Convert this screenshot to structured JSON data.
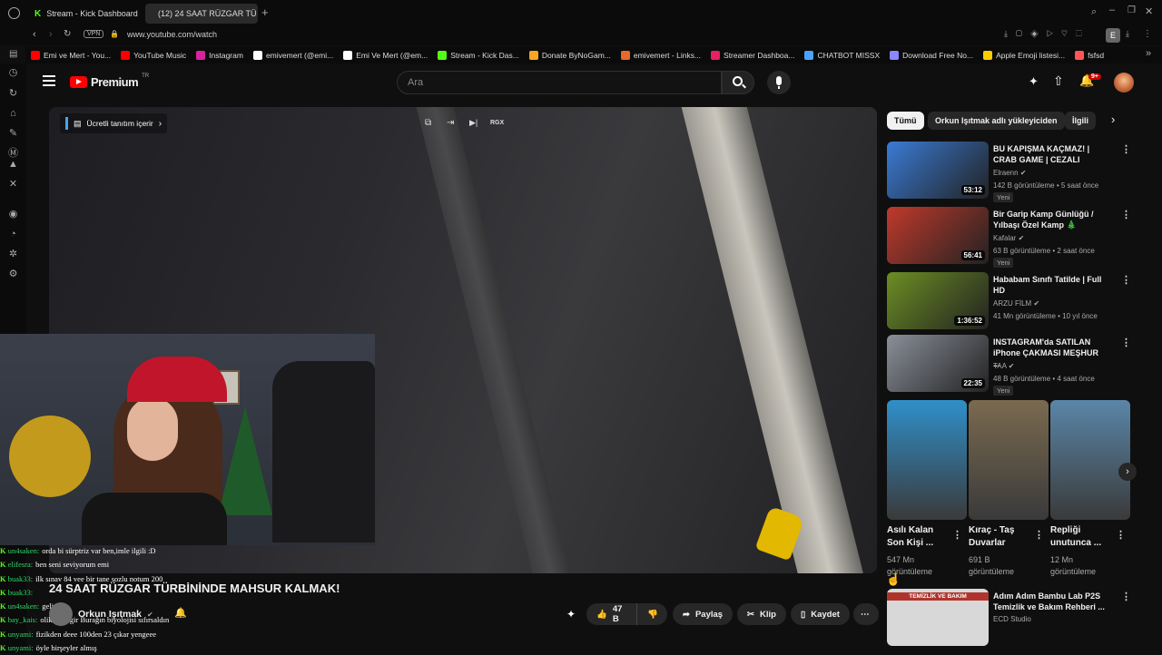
{
  "browser": {
    "tabs": [
      {
        "label": "Stream - Kick Dashboard",
        "active": false
      },
      {
        "label": "(12) 24 SAAT RÜZGAR TÜ",
        "active": true
      }
    ],
    "address": "www.youtube.com/watch",
    "vpn_label": "VPN",
    "profile_letter": "E",
    "bookmarks": [
      {
        "label": "Emi ve Mert - You...",
        "color": "#ff0000"
      },
      {
        "label": "YouTube Music",
        "color": "#ff0000"
      },
      {
        "label": "Instagram",
        "color": "#d6249f"
      },
      {
        "label": "emivemert (@emi...",
        "color": "#ffffff"
      },
      {
        "label": "Emi Ve Mert (@em...",
        "color": "#ffffff"
      },
      {
        "label": "Stream - Kick Das...",
        "color": "#53fc18"
      },
      {
        "label": "Donate ByNoGam...",
        "color": "#f5a623"
      },
      {
        "label": "emivemert - Links...",
        "color": "#e66a2c"
      },
      {
        "label": "Streamer Dashboa...",
        "color": "#e91e63"
      },
      {
        "label": "CHATBOT MISSX",
        "color": "#4aa3ff"
      },
      {
        "label": "Download Free No...",
        "color": "#8888ff"
      },
      {
        "label": "Apple Emoji listesi...",
        "color": "#ffcc00"
      },
      {
        "label": "fsfsd",
        "color": "#ff5555"
      }
    ]
  },
  "youtube": {
    "logo_text": "Premium",
    "logo_sup": "TR",
    "search_placeholder": "Ara",
    "notif_badge": "9+"
  },
  "player": {
    "promo_label": "Ücretli tanıtım içerir",
    "control_label": "RGX"
  },
  "video": {
    "title": "24 SAAT RÜZGAR TÜRBİNİNDE MAHSUR KALMAK!",
    "channel": "Orkun Işıtmak",
    "likes": "47 B",
    "share": "Paylaş",
    "clip": "Klip",
    "save": "Kaydet"
  },
  "chat": [
    {
      "user": "un4saken:",
      "msg": "orda bi sürptriz var ben,imle ilgili :D"
    },
    {
      "user": "elifesra:",
      "msg": "ben seni seviyorum emi"
    },
    {
      "user": "buak33:",
      "msg": "ilk sınav 84 vee bir tane sozlu notum 200"
    },
    {
      "user": "buak33:",
      "msg": ""
    },
    {
      "user": "un4saken:",
      "msg": "gelir mi"
    },
    {
      "user": "bay_kais:",
      "msg": "olik kasa gir Burağın biyolojisi sıfırsaldın"
    },
    {
      "user": "unyami:",
      "msg": "fizikden deee 100den 23 çıkar yengeee"
    },
    {
      "user": "unyami:",
      "msg": "öyle birşeyler almış"
    }
  ],
  "chips": [
    "Tümü",
    "Orkun Işıtmak adlı yükleyiciden",
    "İlgili"
  ],
  "recommendations": [
    {
      "title": "BU KAPIŞMA KAÇMAZ! | CRAB GAME | CEZALI",
      "channel": "Elraenn",
      "meta": "142 B görüntüleme • 5 saat önce",
      "badge": "Yeni",
      "duration": "53:12",
      "thumb": "#3a7bd5"
    },
    {
      "title": "Bir Garip Kamp Günlüğü / Yılbaşı Özel Kamp 🎄",
      "channel": "Kafalar",
      "meta": "63 B görüntüleme • 2 saat önce",
      "badge": "Yeni",
      "duration": "56:41",
      "thumb": "#c0392b"
    },
    {
      "title": "Hababam Sınıfı Tatilde | Full HD",
      "channel": "ARZU FİLM",
      "meta": "41 Mn görüntüleme • 10 yıl önce",
      "badge": "",
      "duration": "1:36:52",
      "thumb": "#6b8e23"
    },
    {
      "title": "INSTAGRAM'da SATILAN iPhone ÇAKMASI MEŞHUR ...",
      "channel": "TAA",
      "meta": "48 B görüntüleme • 4 saat önce",
      "badge": "Yeni",
      "duration": "22:35",
      "thumb": "#8a8f99"
    }
  ],
  "shorts": [
    {
      "title": "Asılı Kalan Son Kişi ...",
      "views": "547 Mn görüntüleme",
      "thumb": "#2f8fc9"
    },
    {
      "title": "Kıraç - Taş Duvarlar",
      "views": "691 B görüntüleme",
      "thumb": "#7a6a4f"
    },
    {
      "title": "Repliği unutunca ...",
      "views": "12 Mn görüntüleme",
      "thumb": "#5a86a8"
    }
  ],
  "last_rec": {
    "title": "Adım Adım Bambu Lab P2S Temizlik ve Bakım Rehberi ...",
    "channel": "ECD Studio",
    "thumb_text": "TEMİZLİK VE BAKIM"
  }
}
